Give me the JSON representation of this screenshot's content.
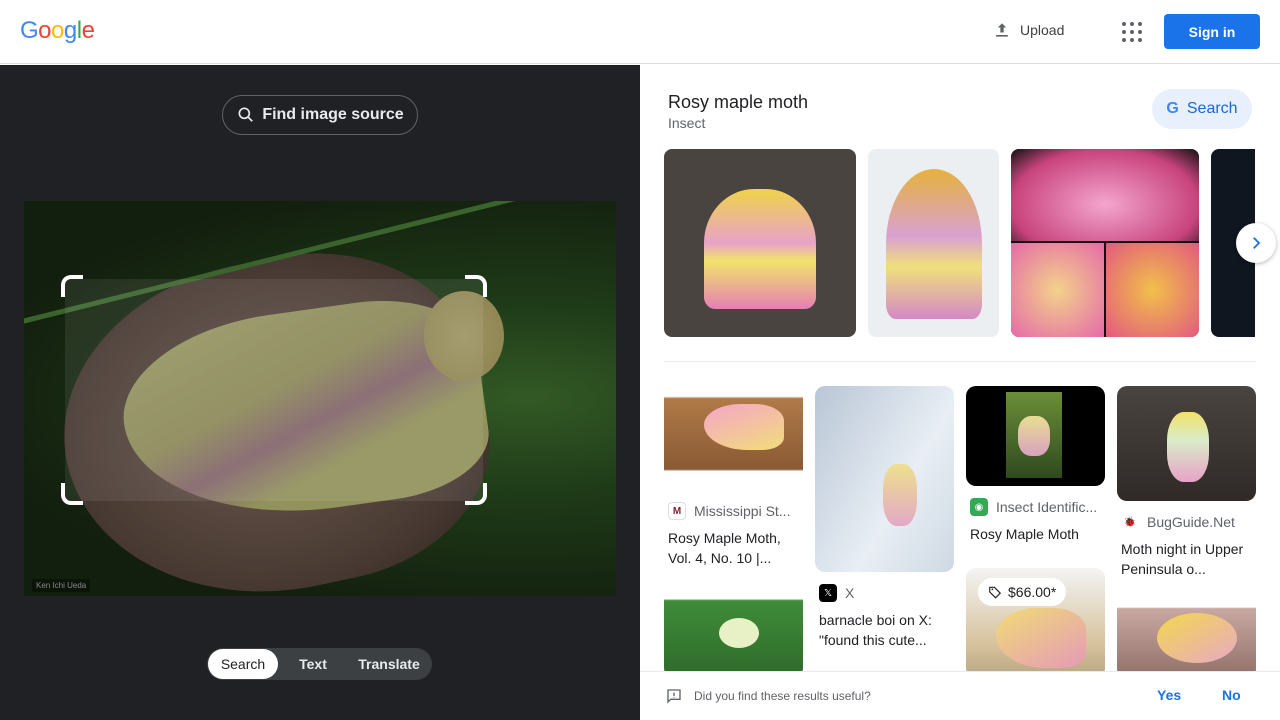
{
  "header": {
    "logo": "Google",
    "upload_label": "Upload",
    "signin_label": "Sign in"
  },
  "left_panel": {
    "find_source_label": "Find image source",
    "watermark": "Ken Ichi Ueda",
    "modes": [
      "Search",
      "Text",
      "Translate"
    ],
    "active_mode": "Search"
  },
  "knowledge": {
    "title": "Rosy maple moth",
    "subtitle": "Insect",
    "search_label": "Search"
  },
  "results": [
    {
      "source": "Mississippi St...",
      "title": "Rosy Maple Moth, Vol. 4, No. 10 |..."
    },
    {
      "source": "X",
      "title": "barnacle boi on X: \"found this cute..."
    },
    {
      "source": "Insect Identific...",
      "title": "Rosy Maple Moth"
    },
    {
      "source": "BugGuide.Net",
      "title": "Moth night in Upper Peninsula o..."
    }
  ],
  "price_badge": "$66.00*",
  "feedback": {
    "question": "Did you find these results useful?",
    "yes": "Yes",
    "no": "No"
  },
  "colors": {
    "primary": "#1a73e8",
    "dark_panel": "#202124"
  },
  "icons": {
    "upload": "upload-icon",
    "apps": "apps-grid-icon",
    "lens": "lens-search-icon",
    "next": "chevron-right-icon",
    "feedback": "feedback-icon",
    "price_tag": "tag-icon"
  }
}
